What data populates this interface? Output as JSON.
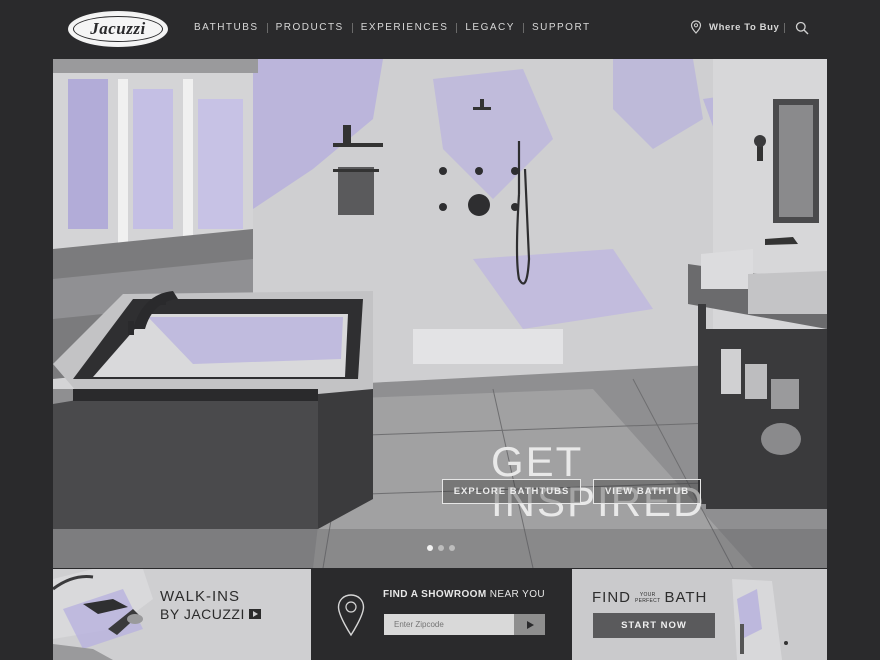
{
  "header": {
    "logo_text": "Jacuzzi",
    "nav": [
      "BATHTUBS",
      "PRODUCTS",
      "EXPERIENCES",
      "LEGACY",
      "SUPPORT"
    ],
    "where_to_buy": "Where To Buy",
    "icons": [
      "location-pin-icon",
      "search-icon"
    ]
  },
  "hero": {
    "title_line1": "GET",
    "title_line2": "INSPIRED",
    "button_explore": "EXPLORE BATHTUBS",
    "button_view": "VIEW BATHTUB",
    "slides": 3,
    "active_slide": 1
  },
  "walkins": {
    "title": "WALK-INS",
    "subtitle": "BY JACUZZI",
    "icon": "play-icon"
  },
  "showroom": {
    "title_bold": "FIND A SHOWROOM",
    "title_rest": " NEAR YOU",
    "placeholder": "Enter Zipcode",
    "icon": "location-pin-icon"
  },
  "find_bath": {
    "find": "FIND",
    "your": "YOUR",
    "perfect": "PERFECT",
    "bath": "BATH",
    "button": "START NOW"
  },
  "colors": {
    "background": "#2a2a2c",
    "accent_lavender": "#b7b0dd",
    "button_gray": "#5a5a5c"
  }
}
